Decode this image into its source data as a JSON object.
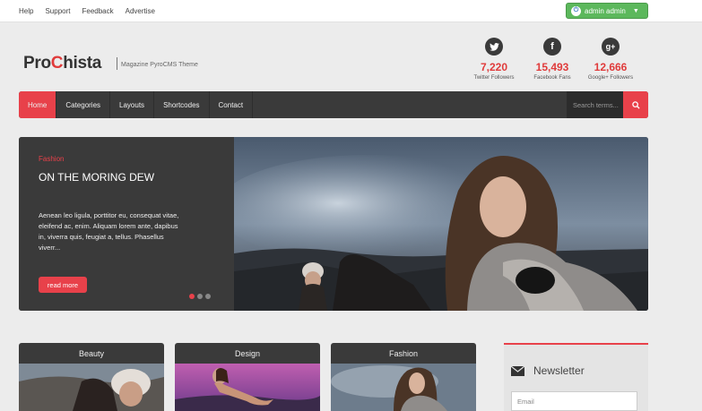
{
  "topbar": {
    "links": [
      "Help",
      "Support",
      "Feedback",
      "Advertise"
    ],
    "admin_label": "admin admin"
  },
  "header": {
    "logo_part1": "Pro",
    "logo_part2": "C",
    "logo_part3": "hista",
    "tagline": "Magazine PyroCMS Theme"
  },
  "social": [
    {
      "icon": "twitter-icon",
      "glyph": "t",
      "count": "7,220",
      "label": "Twitter Followers"
    },
    {
      "icon": "facebook-icon",
      "glyph": "f",
      "count": "15,493",
      "label": "Facebook Fans"
    },
    {
      "icon": "googleplus-icon",
      "glyph": "g+",
      "count": "12,666",
      "label": "Google+ Followers"
    }
  ],
  "nav": {
    "items": [
      "Home",
      "Categories",
      "Layouts",
      "Shortcodes",
      "Contact"
    ],
    "search_placeholder": "Search terms..."
  },
  "slider": {
    "category": "Fashion",
    "title": "ON THE MORING DEW",
    "description": "Aenean leo ligula, porttitor eu, consequat vitae, eleifend ac, enim. Aliquam lorem ante, dapibus in, viverra quis, feugiat a, tellus. Phasellus viverr...",
    "read_more": "read more"
  },
  "cards": [
    "Beauty",
    "Design",
    "Fashion"
  ],
  "newsletter": {
    "title": "Newsletter",
    "email_placeholder": "Email"
  },
  "colors": {
    "accent": "#e8414a",
    "dark": "#3a3a3a",
    "admin_green": "#5cb85c"
  }
}
